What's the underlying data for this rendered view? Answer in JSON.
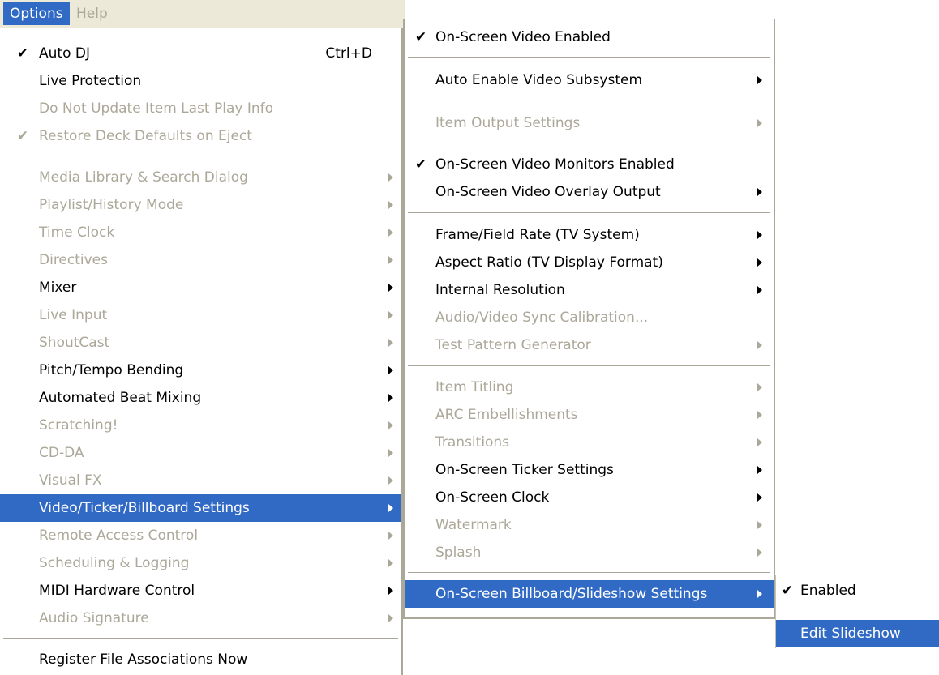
{
  "menubar": {
    "options": "Options",
    "help": "Help"
  },
  "main_menu": {
    "auto_dj": {
      "label": "Auto DJ",
      "shortcut": "Ctrl+D",
      "check": "✔"
    },
    "live_protection": "Live Protection",
    "do_not_update": "Do Not Update Item Last Play Info",
    "restore_deck": {
      "label": "Restore Deck Defaults on Eject",
      "check": "✔"
    },
    "media_library": "Media Library & Search Dialog",
    "playlist_history": "Playlist/History Mode",
    "time_clock": "Time Clock",
    "directives": "Directives",
    "mixer": "Mixer",
    "live_input": "Live Input",
    "shoutcast": "ShoutCast",
    "pitch_tempo": "Pitch/Tempo Bending",
    "beat_mixing": "Automated Beat Mixing",
    "scratching": "Scratching!",
    "cd_da": "CD-DA",
    "visual_fx": "Visual FX",
    "video_ticker": "Video/Ticker/Billboard Settings",
    "remote_access": "Remote Access Control",
    "scheduling": "Scheduling & Logging",
    "midi": "MIDI Hardware Control",
    "audio_signature": "Audio Signature",
    "register_file": "Register File Associations Now"
  },
  "video_menu": {
    "video_enabled": {
      "label": "On-Screen Video Enabled",
      "check": "✔"
    },
    "auto_enable": "Auto Enable Video Subsystem",
    "item_output": "Item Output Settings",
    "monitors_enabled": {
      "label": "On-Screen Video Monitors Enabled",
      "check": "✔"
    },
    "overlay_output": "On-Screen Video Overlay Output",
    "frame_rate": "Frame/Field Rate (TV System)",
    "aspect_ratio": "Aspect Ratio (TV Display Format)",
    "internal_resolution": "Internal Resolution",
    "av_sync": "Audio/Video Sync Calibration...",
    "test_pattern": "Test Pattern Generator",
    "item_titling": "Item Titling",
    "arc": "ARC Embellishments",
    "transitions": "Transitions",
    "ticker": "On-Screen Ticker Settings",
    "clock": "On-Screen Clock",
    "watermark": "Watermark",
    "splash": "Splash",
    "billboard": "On-Screen Billboard/Slideshow Settings"
  },
  "billboard_menu": {
    "enabled": {
      "label": "Enabled",
      "check": "✔"
    },
    "edit_slideshow": "Edit Slideshow"
  },
  "colors": {
    "highlight": "#316ac5",
    "disabled_text": "#aca899",
    "menubar_bg": "#ece9d8"
  }
}
